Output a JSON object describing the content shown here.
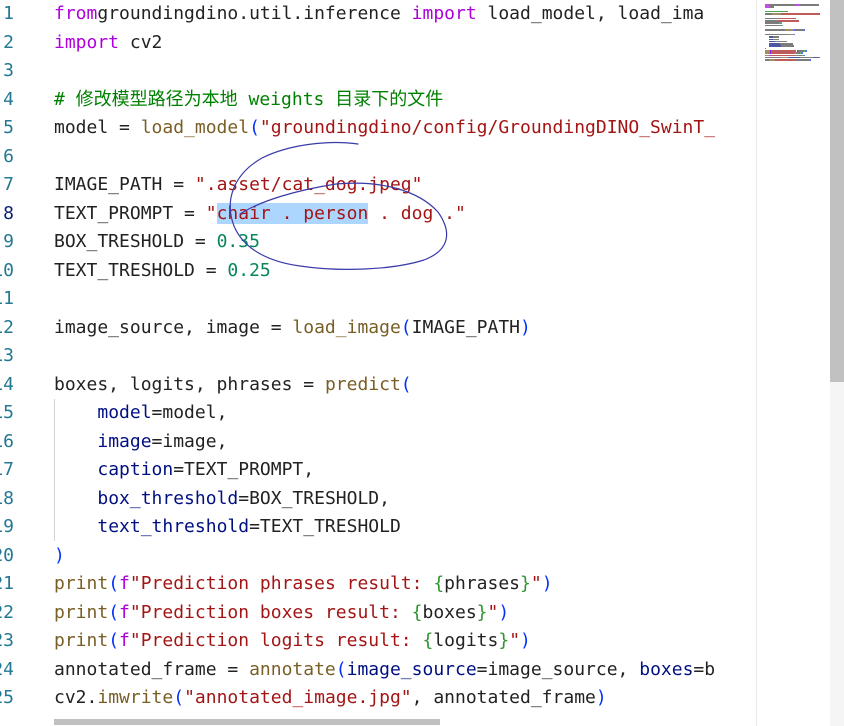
{
  "editor": {
    "lines": [
      {
        "n": "1",
        "t": [
          [
            "k",
            "from"
          ],
          [
            "",
            "groundingdino.util.inference "
          ],
          [
            "k",
            "import"
          ],
          [
            "",
            " load_model, load_ima"
          ]
        ]
      },
      {
        "n": "2",
        "t": [
          [
            "k",
            "import"
          ],
          [
            "",
            " cv2"
          ]
        ]
      },
      {
        "n": "3",
        "t": []
      },
      {
        "n": "4",
        "t": [
          [
            "c",
            "# 修改模型路径为本地 weights 目录下的文件"
          ]
        ]
      },
      {
        "n": "5",
        "t": [
          [
            "",
            "model = "
          ],
          [
            "f",
            "load_model"
          ],
          [
            "p1",
            "("
          ],
          [
            "s",
            "\"groundingdino/config/GroundingDINO_SwinT_"
          ]
        ]
      },
      {
        "n": "6",
        "t": []
      },
      {
        "n": "7",
        "t": [
          [
            "",
            "IMAGE_PATH = "
          ],
          [
            "s",
            "\".asset/cat_dog.jpeg\""
          ]
        ]
      },
      {
        "n": "8",
        "t": [
          [
            "",
            "TEXT_PROMPT = "
          ],
          [
            "s",
            "\""
          ],
          [
            "s hl",
            "chair . person"
          ],
          [
            "s",
            " . dog .\""
          ]
        ]
      },
      {
        "n": "9",
        "t": [
          [
            "",
            "BOX_TRESHOLD = "
          ],
          [
            "n",
            "0.35"
          ]
        ]
      },
      {
        "n": "10",
        "t": [
          [
            "",
            "TEXT_TRESHOLD = "
          ],
          [
            "n",
            "0.25"
          ]
        ]
      },
      {
        "n": "11",
        "t": []
      },
      {
        "n": "12",
        "t": [
          [
            "",
            "image_source, image = "
          ],
          [
            "f",
            "load_image"
          ],
          [
            "p1",
            "("
          ],
          [
            "",
            "IMAGE_PATH"
          ],
          [
            "p1",
            ")"
          ]
        ]
      },
      {
        "n": "13",
        "t": []
      },
      {
        "n": "14",
        "t": [
          [
            "",
            "boxes, logits, phrases = "
          ],
          [
            "f",
            "predict"
          ],
          [
            "p1",
            "("
          ]
        ]
      },
      {
        "n": "15",
        "t": [
          [
            "",
            "    "
          ],
          [
            "v",
            "model"
          ],
          [
            "",
            "=model,"
          ]
        ]
      },
      {
        "n": "16",
        "t": [
          [
            "",
            "    "
          ],
          [
            "v",
            "image"
          ],
          [
            "",
            "=image,"
          ]
        ]
      },
      {
        "n": "17",
        "t": [
          [
            "",
            "    "
          ],
          [
            "v",
            "caption"
          ],
          [
            "",
            "=TEXT_PROMPT,"
          ]
        ]
      },
      {
        "n": "18",
        "t": [
          [
            "",
            "    "
          ],
          [
            "v",
            "box_threshold"
          ],
          [
            "",
            "=BOX_TRESHOLD,"
          ]
        ]
      },
      {
        "n": "19",
        "t": [
          [
            "",
            "    "
          ],
          [
            "v",
            "text_threshold"
          ],
          [
            "",
            "=TEXT_TRESHOLD"
          ]
        ]
      },
      {
        "n": "20",
        "t": [
          [
            "p1",
            ")"
          ]
        ]
      },
      {
        "n": "21",
        "t": [
          [
            "f",
            "print"
          ],
          [
            "p1",
            "("
          ],
          [
            "k",
            "f"
          ],
          [
            "s",
            "\"Prediction phrases result: "
          ],
          [
            "p2",
            "{"
          ],
          [
            "",
            "phrases"
          ],
          [
            "p2",
            "}"
          ],
          [
            "s",
            "\""
          ],
          [
            "p1",
            ")"
          ]
        ]
      },
      {
        "n": "22",
        "t": [
          [
            "f",
            "print"
          ],
          [
            "p1",
            "("
          ],
          [
            "k",
            "f"
          ],
          [
            "s",
            "\"Prediction boxes result: "
          ],
          [
            "p2",
            "{"
          ],
          [
            "",
            "boxes"
          ],
          [
            "p2",
            "}"
          ],
          [
            "s",
            "\""
          ],
          [
            "p1",
            ")"
          ]
        ]
      },
      {
        "n": "23",
        "t": [
          [
            "f",
            "print"
          ],
          [
            "p1",
            "("
          ],
          [
            "k",
            "f"
          ],
          [
            "s",
            "\"Prediction logits result: "
          ],
          [
            "p2",
            "{"
          ],
          [
            "",
            "logits"
          ],
          [
            "p2",
            "}"
          ],
          [
            "s",
            "\""
          ],
          [
            "p1",
            ")"
          ]
        ]
      },
      {
        "n": "24",
        "t": [
          [
            "",
            "annotated_frame = "
          ],
          [
            "f",
            "annotate"
          ],
          [
            "p1",
            "("
          ],
          [
            "v",
            "image_source"
          ],
          [
            "",
            "=image_source, "
          ],
          [
            "v",
            "boxes"
          ],
          [
            "",
            "=b"
          ]
        ]
      },
      {
        "n": "25",
        "t": [
          [
            "",
            "cv2."
          ],
          [
            "f",
            "imwrite"
          ],
          [
            "p1",
            "("
          ],
          [
            "s",
            "\"annotated_image.jpg\""
          ],
          [
            "",
            ", annotated_frame"
          ],
          [
            "p1",
            ")"
          ]
        ]
      }
    ],
    "active_line": "8"
  },
  "colors": {
    "keyword": "#af00db",
    "string": "#a31515",
    "comment": "#008000",
    "number": "#098658",
    "function": "#795e26",
    "parameter": "#001080",
    "line_number": "#237893",
    "selection": "#add6ff",
    "ink": "#3a3aa8"
  },
  "icons": {
    "annotation": "hand-drawn-circle"
  }
}
